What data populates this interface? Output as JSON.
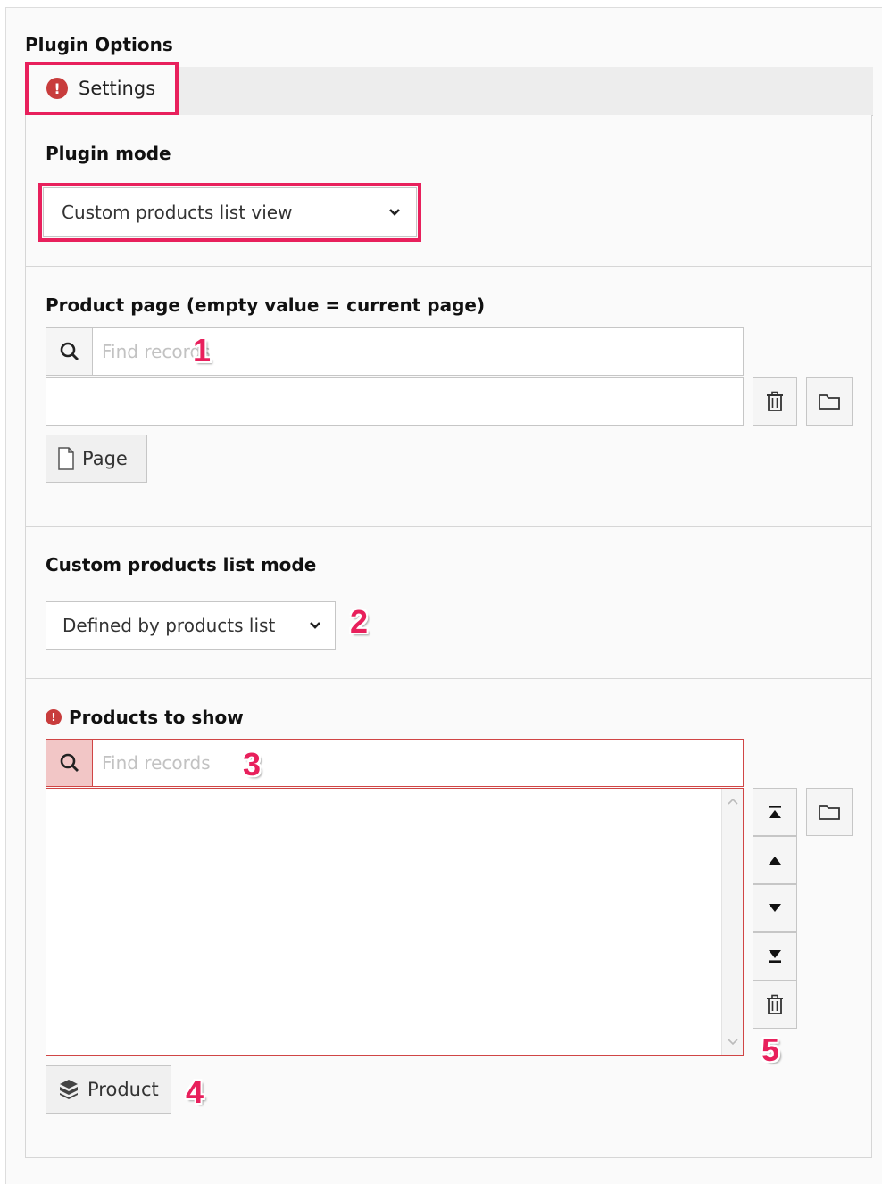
{
  "section_title": "Plugin Options",
  "tab": {
    "label": "Settings",
    "error_glyph": "!"
  },
  "plugin_mode": {
    "label": "Plugin mode",
    "value": "Custom products list view"
  },
  "product_page": {
    "label": "Product page (empty value = current page)",
    "search_placeholder": "Find records",
    "page_button": "Page"
  },
  "list_mode": {
    "label": "Custom products list mode",
    "value": "Defined by products list"
  },
  "products_to_show": {
    "label": "Products to show",
    "search_placeholder": "Find records",
    "product_button": "Product"
  },
  "annotations": [
    "1",
    "2",
    "3",
    "4",
    "5"
  ],
  "colors": {
    "highlight": "#e8205c",
    "error": "#c83c3c"
  }
}
